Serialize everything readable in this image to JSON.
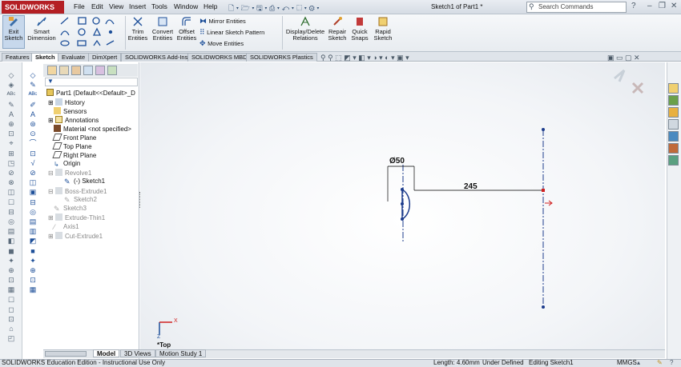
{
  "app": {
    "brand": "SOLIDWORKS",
    "doc_title": "Sketch1 of Part1 *"
  },
  "menu": [
    "File",
    "Edit",
    "View",
    "Insert",
    "Tools",
    "Window",
    "Help"
  ],
  "search": {
    "placeholder": "Search Commands"
  },
  "ribbon": {
    "exit_sketch": "Exit Sketch",
    "smart_dimension": "Smart Dimension",
    "trim_entities": "Trim Entities",
    "convert_entities": "Convert Entities",
    "offset_entities": "Offset Entities",
    "mirror_entities": "Mirror Entities",
    "linear_pattern": "Linear Sketch Pattern",
    "move_entities": "Move Entities",
    "display_delete_relations": "Display/Delete Relations",
    "repair_sketch": "Repair Sketch",
    "quick_snaps": "Quick Snaps",
    "rapid_sketch": "Rapid Sketch"
  },
  "tabs": [
    "Features",
    "Sketch",
    "Evaluate",
    "DimXpert",
    "SOLIDWORKS Add-Ins",
    "SOLIDWORKS MBD",
    "SOLIDWORKS Plastics"
  ],
  "tree": [
    {
      "label": "Part1  (Default<<Default>_D",
      "muted": false
    },
    {
      "label": "History",
      "muted": false
    },
    {
      "label": "Sensors",
      "muted": false
    },
    {
      "label": "Annotations",
      "muted": false
    },
    {
      "label": "Material <not specified>",
      "muted": false
    },
    {
      "label": "Front Plane",
      "muted": false
    },
    {
      "label": "Top Plane",
      "muted": false
    },
    {
      "label": "Right Plane",
      "muted": false
    },
    {
      "label": "Origin",
      "muted": false
    },
    {
      "label": "Revolve1",
      "muted": true
    },
    {
      "label": "(-) Sketch1",
      "muted": false
    },
    {
      "label": "Boss-Extrude1",
      "muted": true
    },
    {
      "label": "Sketch2",
      "muted": true
    },
    {
      "label": "Sketch3",
      "muted": true
    },
    {
      "label": "Extrude-Thin1",
      "muted": true
    },
    {
      "label": "Axis1",
      "muted": true
    },
    {
      "label": "Cut-Extrude1",
      "muted": true
    }
  ],
  "sketch": {
    "dim_diameter": "Ø50",
    "dim_length": "245",
    "view_name": "*Top",
    "triad_x": "X",
    "triad_z": "Z"
  },
  "bottom_tabs": [
    "Model",
    "3D Views",
    "Motion Study 1"
  ],
  "status": {
    "edition": "SOLIDWORKS Education Edition - Instructional Use Only",
    "length": "Length: 4.60mm",
    "defined": "Under Defined",
    "editing": "Editing Sketch1",
    "units": "MMGS"
  }
}
